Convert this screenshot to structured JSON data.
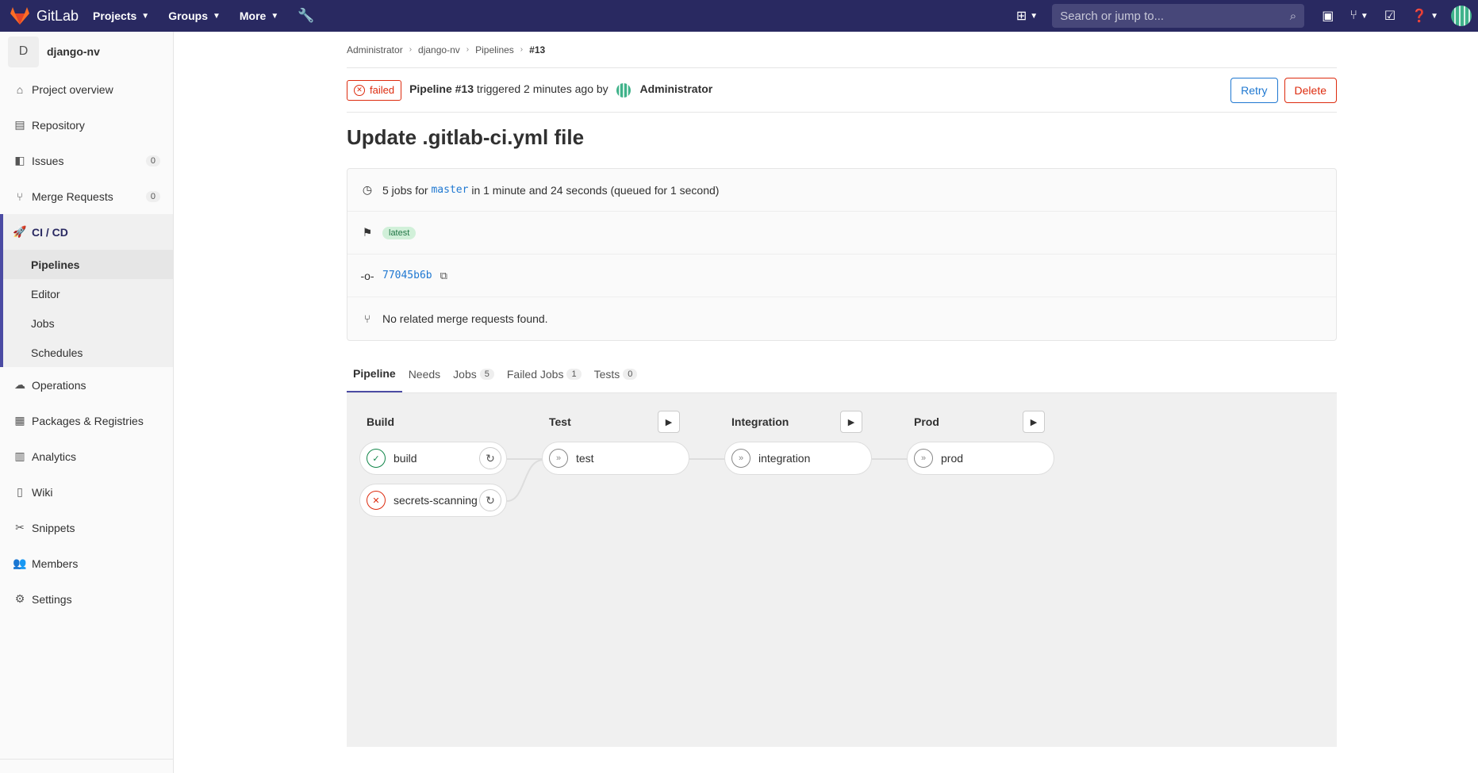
{
  "topbar": {
    "brand": "GitLab",
    "menus": [
      {
        "label": "Projects"
      },
      {
        "label": "Groups"
      },
      {
        "label": "More"
      }
    ],
    "search_placeholder": "Search or jump to..."
  },
  "sidebar": {
    "project_initial": "D",
    "project_name": "django-nv",
    "items": [
      {
        "label": "Project overview",
        "icon": "home-icon"
      },
      {
        "label": "Repository",
        "icon": "doc-icon"
      },
      {
        "label": "Issues",
        "icon": "issues-icon",
        "count": "0"
      },
      {
        "label": "Merge Requests",
        "icon": "merge-icon",
        "count": "0"
      }
    ],
    "cicd": {
      "label": "CI / CD",
      "subitems": [
        "Pipelines",
        "Editor",
        "Jobs",
        "Schedules"
      ]
    },
    "items_after": [
      {
        "label": "Operations"
      },
      {
        "label": "Packages & Registries"
      },
      {
        "label": "Analytics"
      },
      {
        "label": "Wiki"
      },
      {
        "label": "Snippets"
      },
      {
        "label": "Members"
      },
      {
        "label": "Settings"
      }
    ]
  },
  "breadcrumb": [
    "Administrator",
    "django-nv",
    "Pipelines",
    "#13"
  ],
  "pipeline": {
    "status": "failed",
    "name": "Pipeline #13",
    "triggered": "triggered 2 minutes ago by",
    "user": "Administrator",
    "retry_label": "Retry",
    "delete_label": "Delete",
    "title": "Update .gitlab-ci.yml file",
    "jobs_prefix": "5 jobs for",
    "branch": "master",
    "jobs_suffix": "in 1 minute and 24 seconds (queued for 1 second)",
    "tag": "latest",
    "commit": "77045b6b",
    "mr_text": "No related merge requests found."
  },
  "tabs": [
    {
      "label": "Pipeline"
    },
    {
      "label": "Needs"
    },
    {
      "label": "Jobs",
      "count": "5"
    },
    {
      "label": "Failed Jobs",
      "count": "1"
    },
    {
      "label": "Tests",
      "count": "0"
    }
  ],
  "stages": [
    {
      "name": "Build",
      "jobs": [
        {
          "name": "build",
          "status": "success"
        },
        {
          "name": "secrets-scanning",
          "status": "failed"
        }
      ]
    },
    {
      "name": "Test",
      "jobs": [
        {
          "name": "test",
          "status": "skipped"
        }
      ]
    },
    {
      "name": "Integration",
      "jobs": [
        {
          "name": "integration",
          "status": "skipped"
        }
      ]
    },
    {
      "name": "Prod",
      "jobs": [
        {
          "name": "prod",
          "status": "skipped"
        }
      ]
    }
  ]
}
